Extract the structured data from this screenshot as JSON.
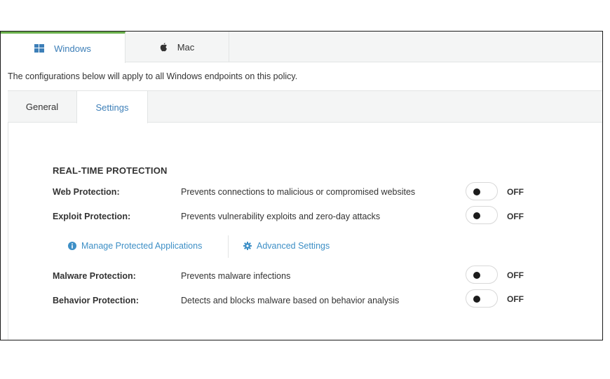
{
  "os_tabs": [
    {
      "label": "Windows",
      "icon": "windows-icon",
      "active": true
    },
    {
      "label": "Mac",
      "icon": "apple-icon",
      "active": false
    }
  ],
  "info_text": "The configurations below will apply to all Windows endpoints on this policy.",
  "sub_tabs": [
    {
      "label": "General",
      "active": false
    },
    {
      "label": "Settings",
      "active": true
    }
  ],
  "section_title": "REAL-TIME PROTECTION",
  "rows": [
    {
      "label": "Web Protection:",
      "description": "Prevents connections to malicious or compromised websites",
      "state": "OFF"
    },
    {
      "label": "Exploit Protection:",
      "description": "Prevents vulnerability exploits and zero-day attacks",
      "state": "OFF"
    },
    {
      "label": "Malware Protection:",
      "description": "Prevents malware infections",
      "state": "OFF"
    },
    {
      "label": "Behavior Protection:",
      "description": "Detects and blocks malware based on behavior analysis",
      "state": "OFF"
    }
  ],
  "links": {
    "manage": {
      "label": "Manage Protected Applications",
      "icon": "info-circle-icon"
    },
    "advanced": {
      "label": "Advanced Settings",
      "icon": "gear-icon"
    }
  },
  "colors": {
    "accent_green": "#6ab04c",
    "link_blue": "#3d8fc6",
    "tab_blue": "#3d7fb8"
  }
}
